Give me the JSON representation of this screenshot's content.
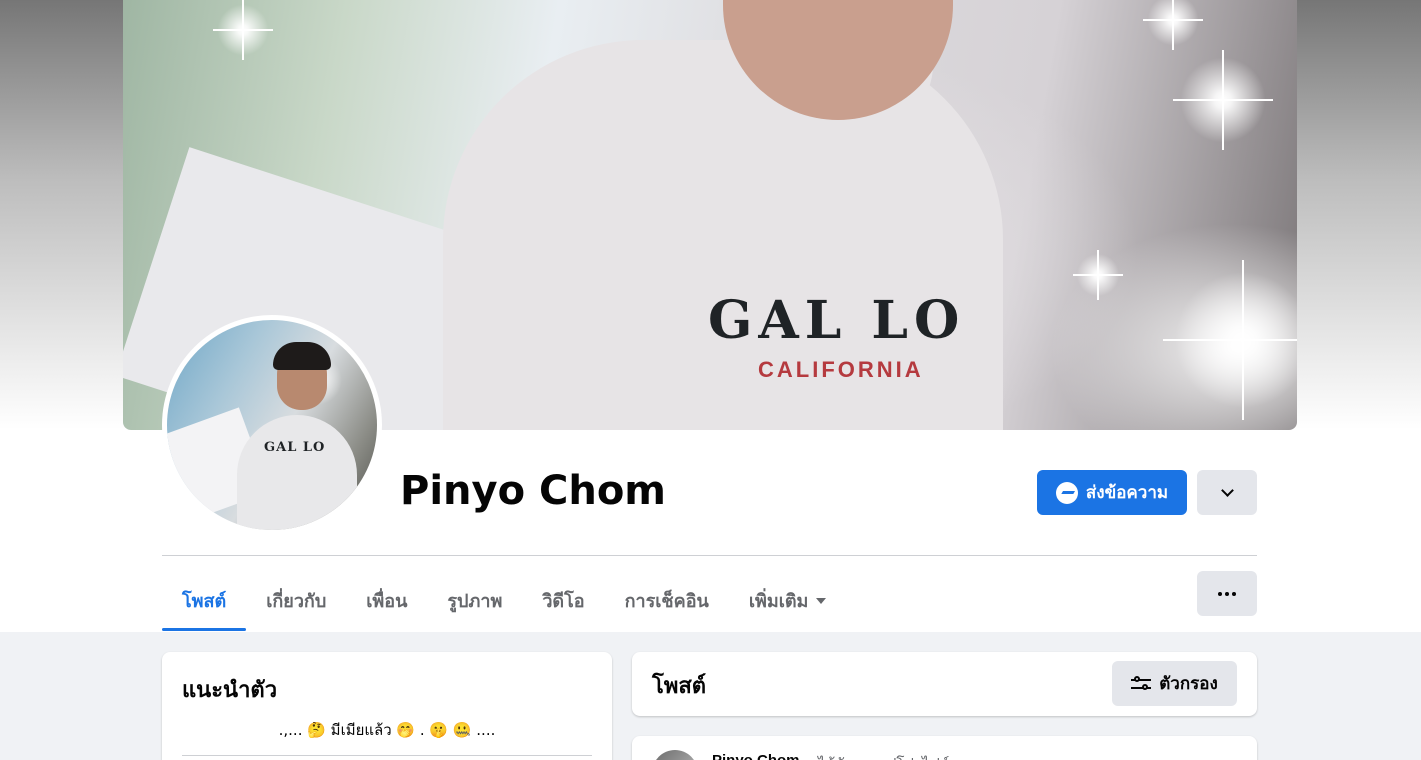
{
  "profile": {
    "name": "Pinyo Chom",
    "cover_text_main": "GAL LO",
    "cover_text_sub": "CALIFORNIA",
    "avatar_text": "GAL LO"
  },
  "actions": {
    "message_label": "ส่งข้อความ",
    "message_icon": "messenger-icon",
    "dropdown_icon": "chevron-down-icon",
    "more_icon": "more-horizontal-icon"
  },
  "tabs": [
    {
      "label": "โพสต์",
      "active": true
    },
    {
      "label": "เกี่ยวกับ",
      "active": false
    },
    {
      "label": "เพื่อน",
      "active": false
    },
    {
      "label": "รูปภาพ",
      "active": false
    },
    {
      "label": "วิดีโอ",
      "active": false
    },
    {
      "label": "การเช็คอิน",
      "active": false
    },
    {
      "label": "เพิ่มเติม",
      "active": false
    }
  ],
  "intro": {
    "title": "แนะนำตัว",
    "bio": ".,... 🤔 มีเมียแล้ว 🤭 . 🤫 🤐 ...."
  },
  "posts": {
    "title": "โพสต์",
    "filter_label": "ตัวกรอง",
    "filter_icon": "sliders-icon",
    "first_post_author": "Pinyo Chom",
    "first_post_action": "ได้อัพเดตรูปโปรไฟล์"
  },
  "colors": {
    "accent": "#1b74e4",
    "button_gray": "#e4e6eb",
    "page_bg": "#f0f2f5",
    "muted_text": "#65676b"
  }
}
